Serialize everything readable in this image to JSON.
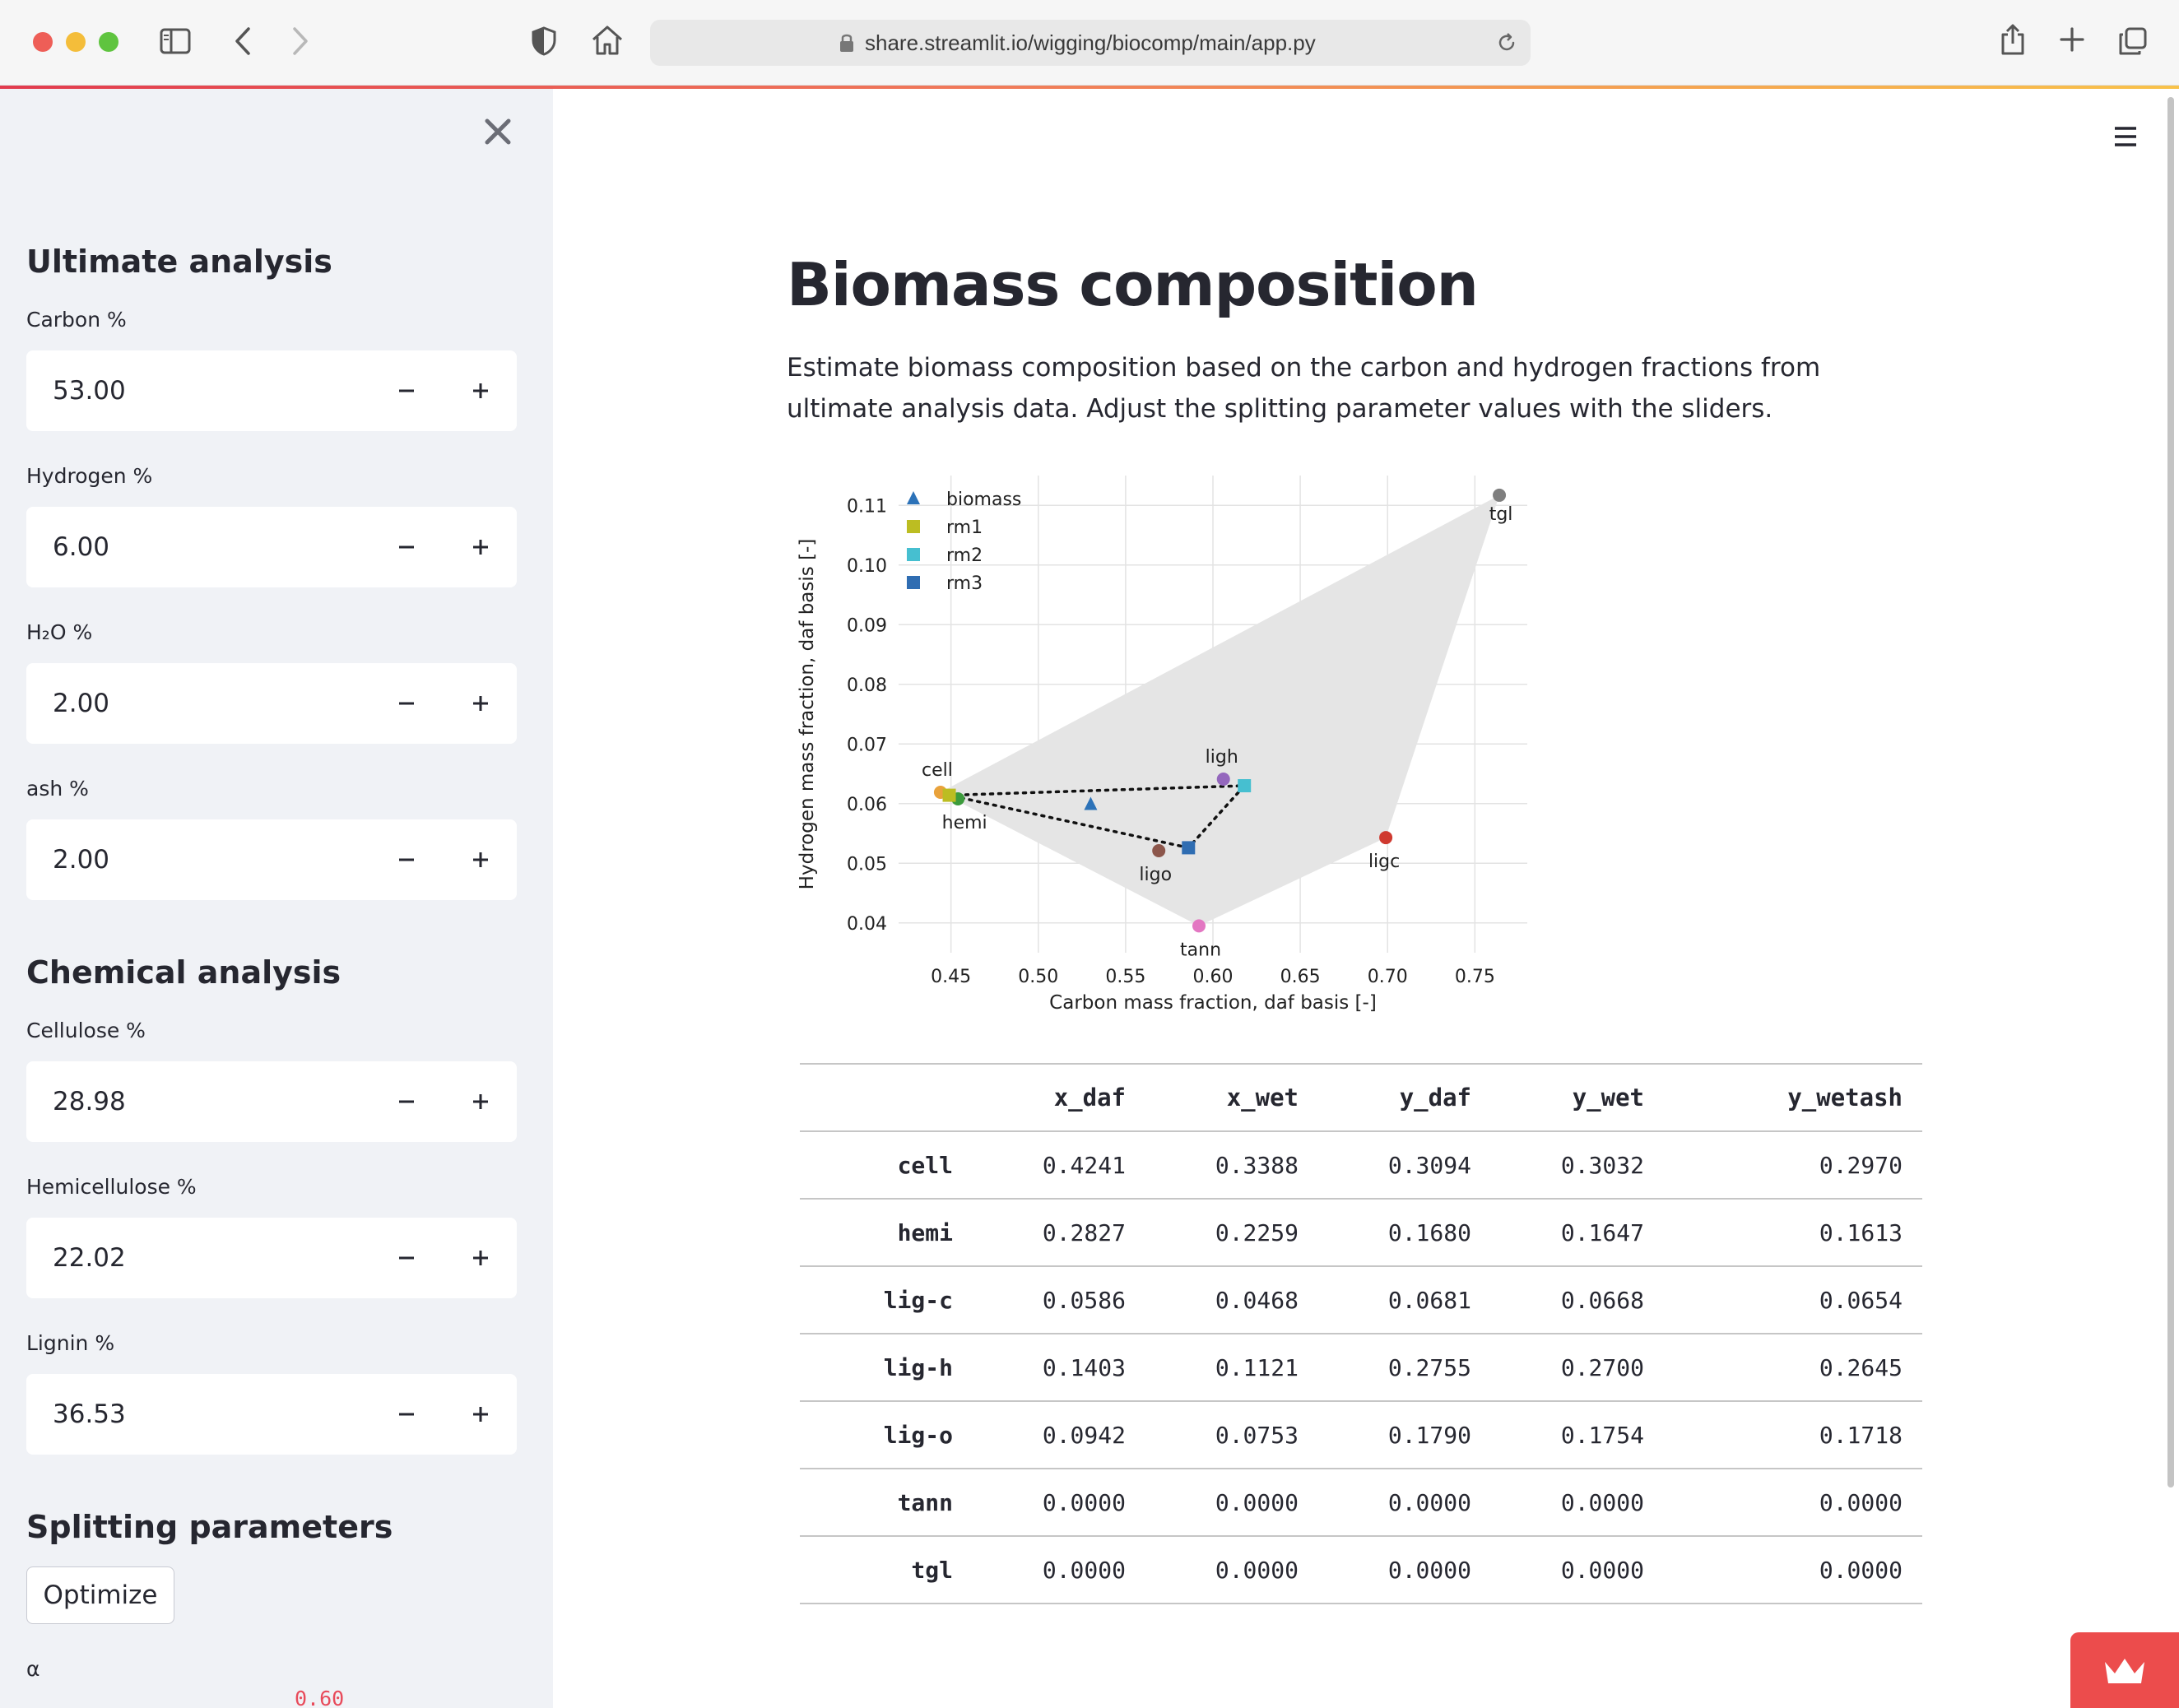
{
  "browser": {
    "url": "share.streamlit.io/wigging/biocomp/main/app.py"
  },
  "sidebar": {
    "ultimate_heading": "Ultimate analysis",
    "chemical_heading": "Chemical analysis",
    "splitting_heading": "Splitting parameters",
    "inputs": [
      {
        "label": "Carbon %",
        "value": "53.00"
      },
      {
        "label": "Hydrogen %",
        "value": "6.00"
      },
      {
        "label": "H₂O %",
        "value": "2.00"
      },
      {
        "label": "ash %",
        "value": "2.00"
      },
      {
        "label": "Cellulose %",
        "value": "28.98"
      },
      {
        "label": "Hemicellulose %",
        "value": "22.02"
      },
      {
        "label": "Lignin %",
        "value": "36.53"
      }
    ],
    "minus_symbol": "−",
    "plus_symbol": "+",
    "optimize_label": "Optimize",
    "alpha_label": "α",
    "alpha_value": "0.60"
  },
  "main": {
    "title": "Biomass composition",
    "description": "Estimate biomass composition based on the carbon and hydrogen fractions from ultimate analysis data. Adjust the splitting parameter values with the sliders."
  },
  "chart_data": {
    "type": "scatter",
    "xlabel": "Carbon mass fraction, daf basis [-]",
    "ylabel": "Hydrogen mass fraction, daf basis [-]",
    "xlim": [
      0.42,
      0.78
    ],
    "ylim": [
      0.035,
      0.115
    ],
    "xticks": [
      0.45,
      0.5,
      0.55,
      0.6,
      0.65,
      0.7,
      0.75
    ],
    "xtick_labels": [
      "0.45",
      "0.50",
      "0.55",
      "0.60",
      "0.65",
      "0.70",
      "0.75"
    ],
    "yticks": [
      0.04,
      0.05,
      0.06,
      0.07,
      0.08,
      0.09,
      0.1,
      0.11
    ],
    "ytick_labels": [
      "0.04",
      "0.05",
      "0.06",
      "0.07",
      "0.08",
      "0.09",
      "0.10",
      "0.11"
    ],
    "grid": true,
    "legend_location": "upper left",
    "region": {
      "color": "#e5e5e5",
      "points": [
        [
          0.444,
          0.0619
        ],
        [
          0.764,
          0.1117
        ],
        [
          0.699,
          0.0543
        ],
        [
          0.592,
          0.0395
        ]
      ]
    },
    "reference_points": [
      {
        "label": "cell",
        "x": 0.444,
        "y": 0.0619,
        "color": "#e9a23b"
      },
      {
        "label": "hemi",
        "x": 0.454,
        "y": 0.0608,
        "color": "#3c9b3c"
      },
      {
        "label": "ligc",
        "x": 0.699,
        "y": 0.0543,
        "color": "#cf3a30"
      },
      {
        "label": "ligh",
        "x": 0.606,
        "y": 0.0641,
        "color": "#9467bd"
      },
      {
        "label": "ligo",
        "x": 0.569,
        "y": 0.0521,
        "color": "#8c564b"
      },
      {
        "label": "tann",
        "x": 0.592,
        "y": 0.0395,
        "color": "#e377c2"
      },
      {
        "label": "tgl",
        "x": 0.764,
        "y": 0.1117,
        "color": "#7f7f7f"
      }
    ],
    "series": [
      {
        "name": "biomass",
        "marker": "triangle",
        "color": "#2c72b8",
        "points": [
          [
            0.53,
            0.0599
          ]
        ]
      },
      {
        "name": "rm1",
        "marker": "square",
        "color": "#bcbd22",
        "points": [
          [
            0.449,
            0.0614
          ]
        ]
      },
      {
        "name": "rm2",
        "marker": "square",
        "color": "#46bfd0",
        "points": [
          [
            0.618,
            0.063
          ]
        ]
      },
      {
        "name": "rm3",
        "marker": "square",
        "color": "#2f6db2",
        "points": [
          [
            0.586,
            0.0526
          ]
        ]
      }
    ],
    "triangle_path": [
      [
        0.449,
        0.0614
      ],
      [
        0.618,
        0.063
      ],
      [
        0.586,
        0.0526
      ],
      [
        0.449,
        0.0614
      ]
    ]
  },
  "table": {
    "columns": [
      "",
      "x_daf",
      "x_wet",
      "y_daf",
      "y_wet",
      "y_wetash"
    ],
    "rows": [
      {
        "name": "cell",
        "values": [
          "0.4241",
          "0.3388",
          "0.3094",
          "0.3032",
          "0.2970"
        ]
      },
      {
        "name": "hemi",
        "values": [
          "0.2827",
          "0.2259",
          "0.1680",
          "0.1647",
          "0.1613"
        ]
      },
      {
        "name": "lig-c",
        "values": [
          "0.0586",
          "0.0468",
          "0.0681",
          "0.0668",
          "0.0654"
        ]
      },
      {
        "name": "lig-h",
        "values": [
          "0.1403",
          "0.1121",
          "0.2755",
          "0.2700",
          "0.2645"
        ]
      },
      {
        "name": "lig-o",
        "values": [
          "0.0942",
          "0.0753",
          "0.1790",
          "0.1754",
          "0.1718"
        ]
      },
      {
        "name": "tann",
        "values": [
          "0.0000",
          "0.0000",
          "0.0000",
          "0.0000",
          "0.0000"
        ]
      },
      {
        "name": "tgl",
        "values": [
          "0.0000",
          "0.0000",
          "0.0000",
          "0.0000",
          "0.0000"
        ]
      }
    ]
  }
}
